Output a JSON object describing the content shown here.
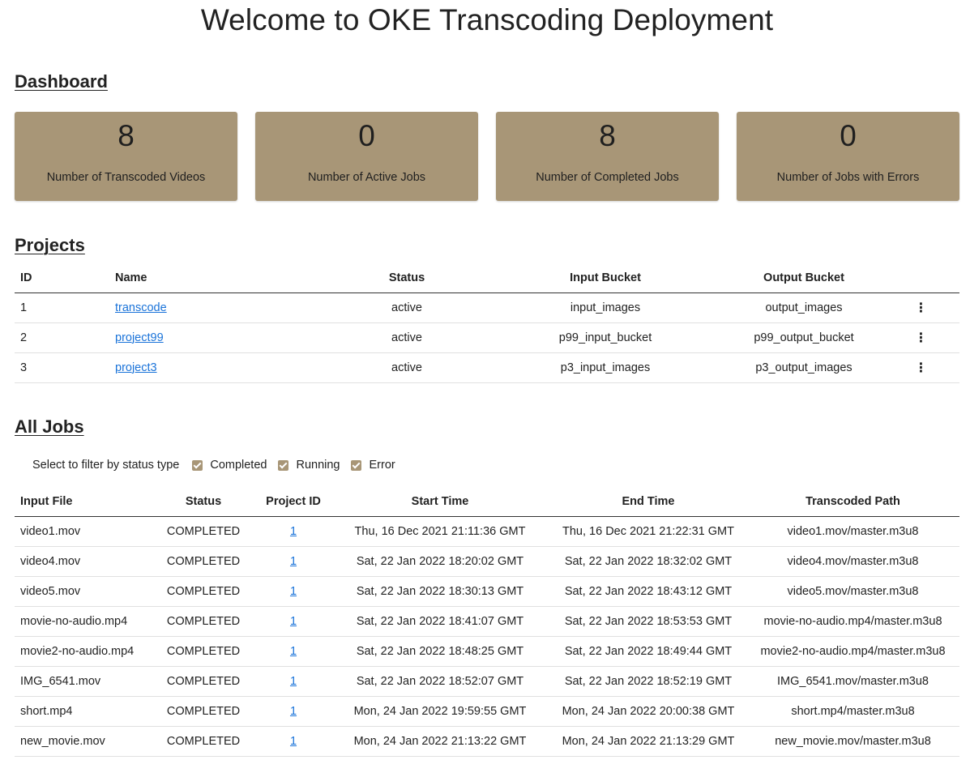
{
  "page_title": "Welcome to OKE Transcoding Deployment",
  "dashboard": {
    "title": "Dashboard",
    "cards": [
      {
        "value": "8",
        "label": "Number of Transcoded Videos"
      },
      {
        "value": "0",
        "label": "Number of Active Jobs"
      },
      {
        "value": "8",
        "label": "Number of Completed Jobs"
      },
      {
        "value": "0",
        "label": "Number of Jobs with Errors"
      }
    ],
    "card_color": "#a89677"
  },
  "projects": {
    "title": "Projects",
    "headers": [
      "ID",
      "Name",
      "Status",
      "Input Bucket",
      "Output Bucket"
    ],
    "rows": [
      {
        "id": "1",
        "name": "transcode",
        "status": "active",
        "input_bucket": "input_images",
        "output_bucket": "output_images"
      },
      {
        "id": "2",
        "name": "project99",
        "status": "active",
        "input_bucket": "p99_input_bucket",
        "output_bucket": "p99_output_bucket"
      },
      {
        "id": "3",
        "name": "project3",
        "status": "active",
        "input_bucket": "p3_input_images",
        "output_bucket": "p3_output_images"
      }
    ],
    "menu_icon": "more-vertical-icon"
  },
  "jobs": {
    "title": "All Jobs",
    "filter": {
      "label": "Select to filter by status type",
      "options": [
        {
          "label": "Completed",
          "checked": true
        },
        {
          "label": "Running",
          "checked": true
        },
        {
          "label": "Error",
          "checked": true
        }
      ]
    },
    "headers": [
      "Input File",
      "Status",
      "Project ID",
      "Start Time",
      "End Time",
      "Transcoded Path"
    ],
    "rows": [
      {
        "input_file": "video1.mov",
        "status": "COMPLETED",
        "project_id": "1",
        "start": "Thu, 16 Dec 2021 21:11:36 GMT",
        "end": "Thu, 16 Dec 2021 21:22:31 GMT",
        "path": "video1.mov/master.m3u8"
      },
      {
        "input_file": "video4.mov",
        "status": "COMPLETED",
        "project_id": "1",
        "start": "Sat, 22 Jan 2022 18:20:02 GMT",
        "end": "Sat, 22 Jan 2022 18:32:02 GMT",
        "path": "video4.mov/master.m3u8"
      },
      {
        "input_file": "video5.mov",
        "status": "COMPLETED",
        "project_id": "1",
        "start": "Sat, 22 Jan 2022 18:30:13 GMT",
        "end": "Sat, 22 Jan 2022 18:43:12 GMT",
        "path": "video5.mov/master.m3u8"
      },
      {
        "input_file": "movie-no-audio.mp4",
        "status": "COMPLETED",
        "project_id": "1",
        "start": "Sat, 22 Jan 2022 18:41:07 GMT",
        "end": "Sat, 22 Jan 2022 18:53:53 GMT",
        "path": "movie-no-audio.mp4/master.m3u8"
      },
      {
        "input_file": "movie2-no-audio.mp4",
        "status": "COMPLETED",
        "project_id": "1",
        "start": "Sat, 22 Jan 2022 18:48:25 GMT",
        "end": "Sat, 22 Jan 2022 18:49:44 GMT",
        "path": "movie2-no-audio.mp4/master.m3u8"
      },
      {
        "input_file": "IMG_6541.mov",
        "status": "COMPLETED",
        "project_id": "1",
        "start": "Sat, 22 Jan 2022 18:52:07 GMT",
        "end": "Sat, 22 Jan 2022 18:52:19 GMT",
        "path": "IMG_6541.mov/master.m3u8"
      },
      {
        "input_file": "short.mp4",
        "status": "COMPLETED",
        "project_id": "1",
        "start": "Mon, 24 Jan 2022 19:59:55 GMT",
        "end": "Mon, 24 Jan 2022 20:00:38 GMT",
        "path": "short.mp4/master.m3u8"
      },
      {
        "input_file": "new_movie.mov",
        "status": "COMPLETED",
        "project_id": "1",
        "start": "Mon, 24 Jan 2022 21:13:22 GMT",
        "end": "Mon, 24 Jan 2022 21:13:29 GMT",
        "path": "new_movie.mov/master.m3u8"
      }
    ],
    "link_color": "#1a73d9"
  }
}
